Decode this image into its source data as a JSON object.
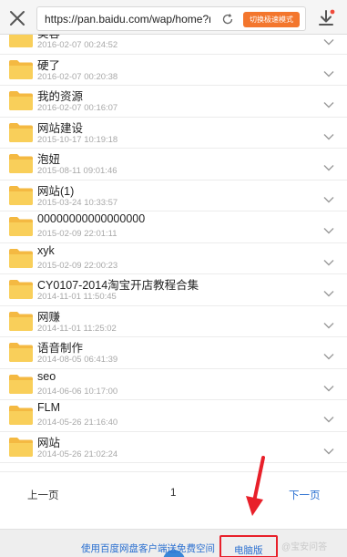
{
  "browser": {
    "url": "https://pan.baidu.com/wap/home?re...",
    "speed_mode_label": "切换极速模式",
    "close_icon": "close-icon",
    "reload_icon": "reload-icon",
    "download_icon": "download-icon"
  },
  "files": [
    {
      "name": "美容",
      "date": "2016-02-07 00:24:52"
    },
    {
      "name": "硬了",
      "date": "2016-02-07 00:20:38"
    },
    {
      "name": "我的资源",
      "date": "2016-02-07 00:16:07"
    },
    {
      "name": "网站建设",
      "date": "2015-10-17 10:19:18"
    },
    {
      "name": "泡妞",
      "date": "2015-08-11 09:01:46"
    },
    {
      "name": "网站(1)",
      "date": "2015-03-24 10:33:57"
    },
    {
      "name": "00000000000000000",
      "date": "2015-02-09 22:01:11"
    },
    {
      "name": "xyk",
      "date": "2015-02-09 22:00:23"
    },
    {
      "name": "CY0107-2014淘宝开店教程合集",
      "date": "2014-11-01 11:50:45"
    },
    {
      "name": "网赚",
      "date": "2014-11-01 11:25:02"
    },
    {
      "name": "语音制作",
      "date": "2014-08-05 06:41:39"
    },
    {
      "name": "seo",
      "date": "2014-06-06 10:17:00"
    },
    {
      "name": "FLM",
      "date": "2014-05-26 21:16:40"
    },
    {
      "name": "网站",
      "date": "2014-05-26 21:02:24"
    }
  ],
  "pagination": {
    "prev_label": "上一页",
    "current_page": "1",
    "next_label": "下一页"
  },
  "footer": {
    "promo_text": "使用百度网盘客户端送免费空间",
    "pc_version_label": "电脑版",
    "watermark": "@宝安问答"
  },
  "colors": {
    "accent_orange": "#f3762d",
    "link_blue": "#2a6fd0",
    "annotation_red": "#e8202a",
    "folder_yellow": "#f7c948"
  }
}
